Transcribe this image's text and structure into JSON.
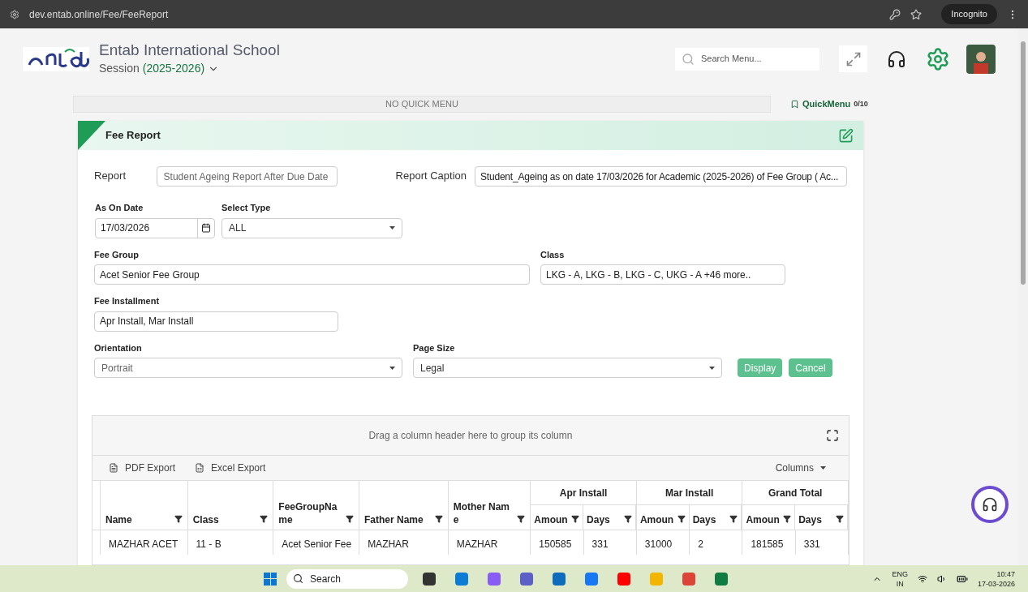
{
  "browser": {
    "url": "dev.entab.online/Fee/FeeReport",
    "mode_label": "Incognito"
  },
  "header": {
    "school_name": "Entab International School",
    "session_label": "Session",
    "session_value": "(2025-2026)",
    "search_placeholder": "Search Menu..."
  },
  "quick_menu": {
    "empty_text": "NO QUICK MENU",
    "label": "QuickMenu",
    "count": "0/10"
  },
  "panel": {
    "title": "Fee Report",
    "report": {
      "label": "Report",
      "value": "Student Ageing Report After Due Date"
    },
    "caption": {
      "label": "Report Caption",
      "value": "Student_Ageing as on date  17/03/2026  for Academic (2025-2026)  of Fee Group ( Ac..."
    },
    "as_on_date": {
      "label": "As On Date",
      "value": "17/03/2026"
    },
    "select_type": {
      "label": "Select Type",
      "value": "ALL"
    },
    "fee_group": {
      "label": "Fee Group",
      "value": "Acet Senior Fee Group"
    },
    "class": {
      "label": "Class",
      "value": "LKG - A, LKG - B, LKG - C, UKG - A  +46 more.."
    },
    "fee_installment": {
      "label": "Fee Installment",
      "value": "Apr Install, Mar Install"
    },
    "orientation": {
      "label": "Orientation",
      "value": "Portrait"
    },
    "page_size": {
      "label": "Page Size",
      "value": "Legal"
    },
    "buttons": [
      "Display",
      "Cancel"
    ]
  },
  "grid": {
    "group_hint": "Drag a column header here to group its column",
    "exports": [
      {
        "kind": "pdf",
        "label": "PDF Export"
      },
      {
        "kind": "excel",
        "label": "Excel Export"
      }
    ],
    "columns_label": "Columns",
    "columns": [
      "Name",
      "Class",
      "FeeGroupName",
      "Father Name",
      "Mother Name"
    ],
    "groups": [
      {
        "title": "Apr Install",
        "sub": [
          "Amoun",
          "Days"
        ]
      },
      {
        "title": "Mar Install",
        "sub": [
          "Amoun",
          "Days"
        ]
      },
      {
        "title": "Grand Total",
        "sub": [
          "Amoun",
          "Days"
        ]
      }
    ],
    "row": [
      "MAZHAR ACET",
      "11 - B",
      "Acet Senior Fee",
      "MAZHAR",
      "MAZHAR",
      "150585",
      "331",
      "31000",
      "2",
      "181585",
      "331"
    ]
  },
  "taskbar": {
    "search": "Search",
    "lang": "ENG",
    "region": "IN",
    "time": "10:47",
    "date": "17-03-2026"
  }
}
